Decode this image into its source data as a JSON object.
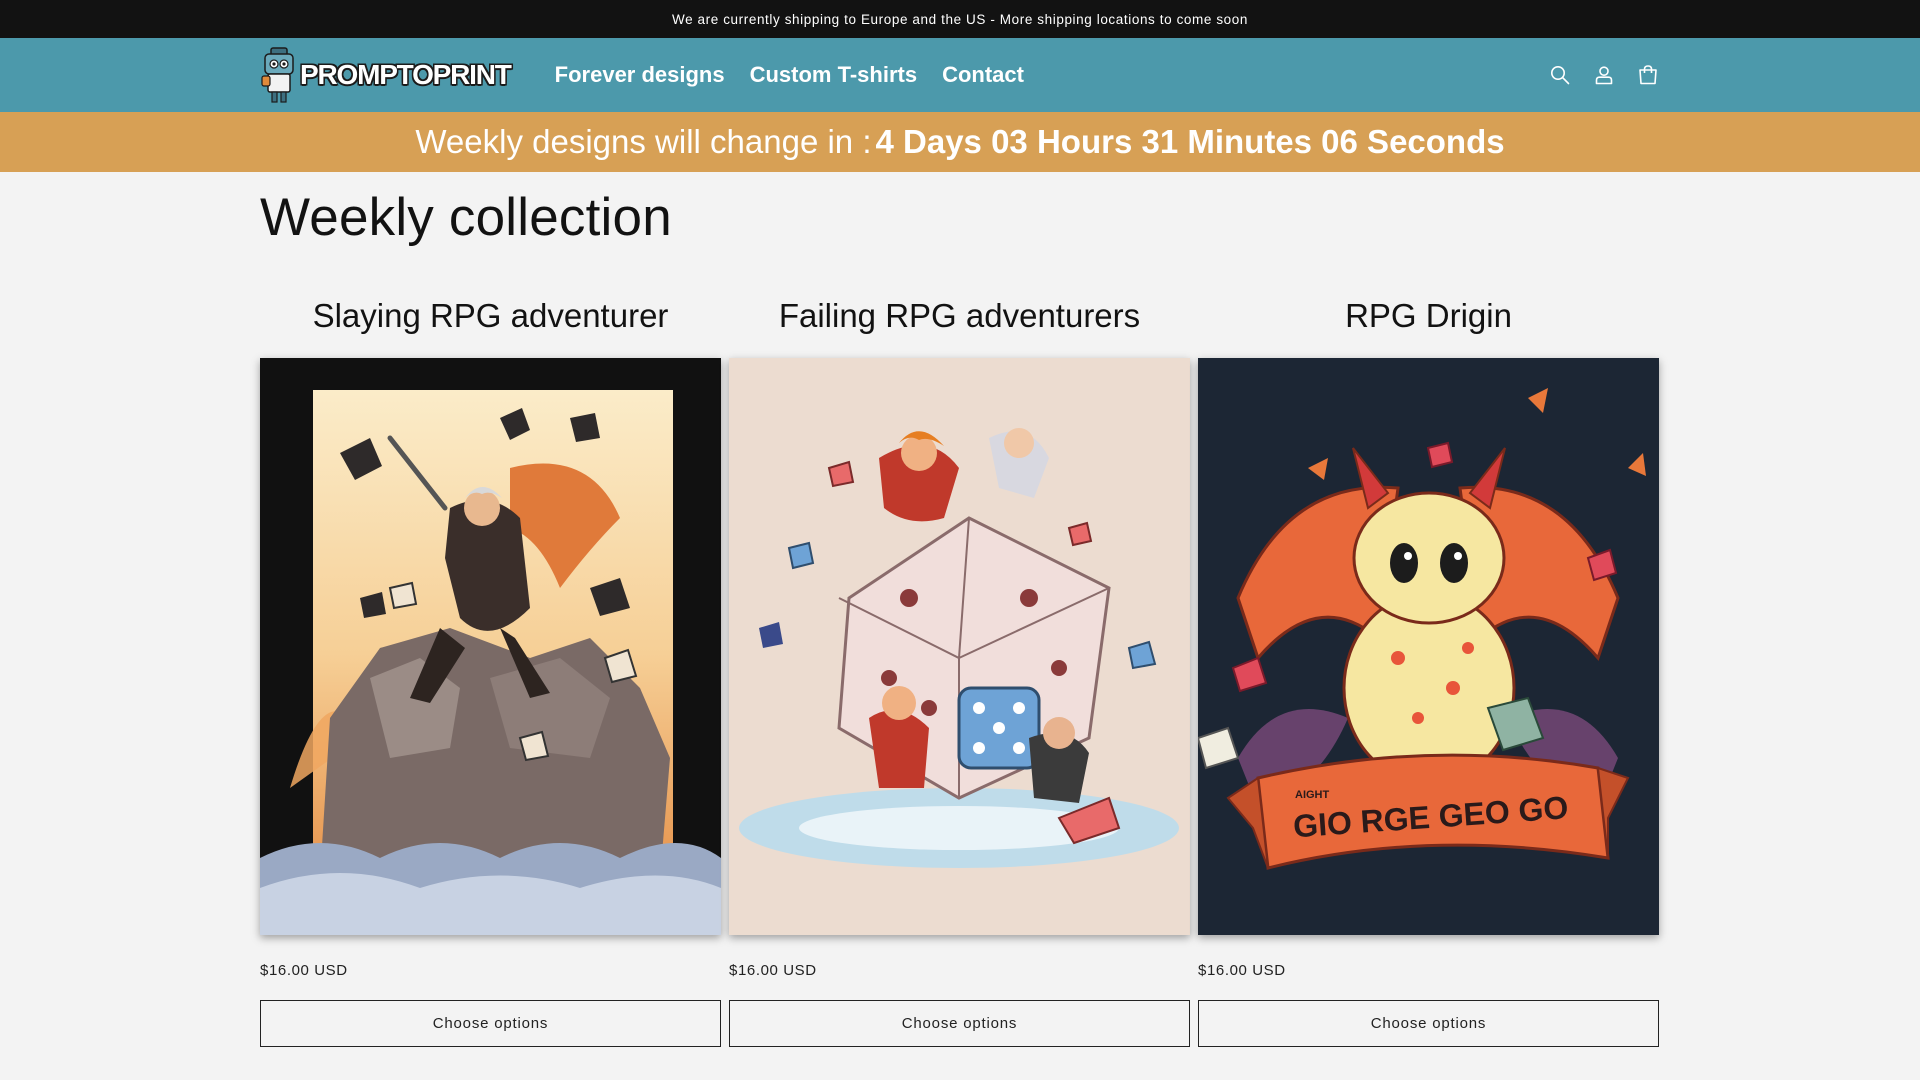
{
  "announcement": "We are currently shipping to Europe and the US - More shipping locations to come soon",
  "header": {
    "logo_text": "PROMPTOPRINT",
    "nav": [
      "Forever designs",
      "Custom T-shirts",
      "Contact"
    ],
    "icons": [
      "search-icon",
      "account-icon",
      "cart-icon"
    ]
  },
  "countdown": {
    "label": "Weekly designs will change in :",
    "value": "4 Days 03 Hours 31 Minutes 06 Seconds"
  },
  "page_title": "Weekly collection",
  "products": [
    {
      "title": "Slaying RPG adventurer",
      "price": "$16.00 USD",
      "button": "Choose options"
    },
    {
      "title": "Failing RPG adventurers",
      "price": "$16.00 USD",
      "button": "Choose options"
    },
    {
      "title": "RPG Drigin",
      "price": "$16.00 USD",
      "button": "Choose options",
      "banner_text": "GIO RGE GEO GO",
      "banner_small": "AIGHT"
    }
  ],
  "colors": {
    "announcement_bg": "#121212",
    "header_bg": "#4c99ab",
    "countdown_bg": "#d7a055",
    "page_bg": "#f3f3f3"
  }
}
